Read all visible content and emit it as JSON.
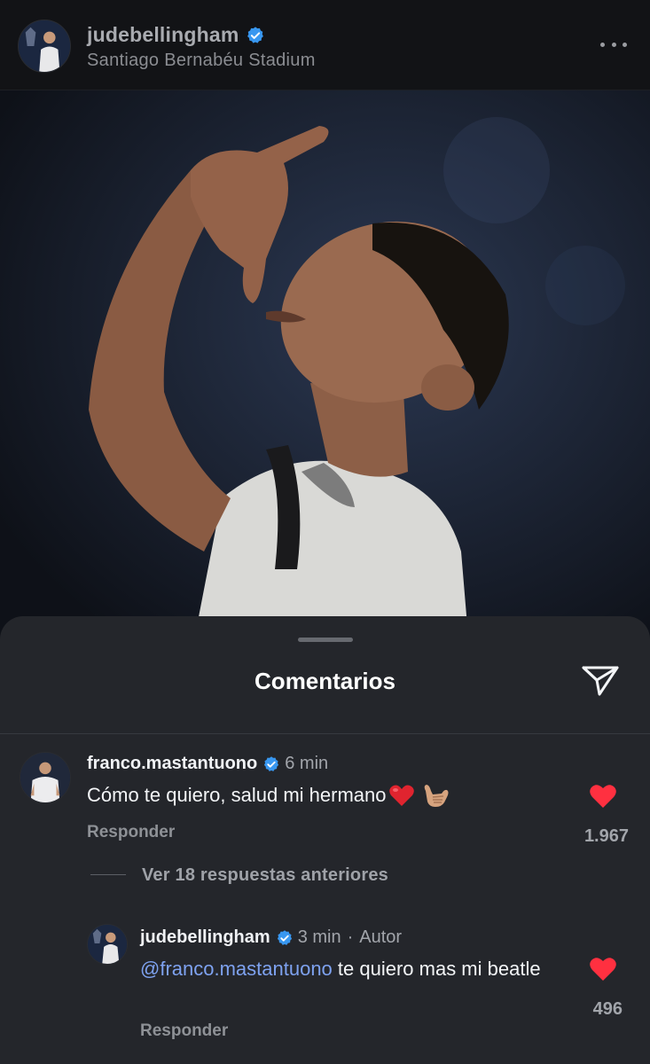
{
  "post": {
    "username": "judebellingham",
    "location": "Santiago Bernabéu Stadium",
    "verified": true
  },
  "comments_sheet": {
    "title": "Comentarios",
    "comments": [
      {
        "username": "franco.mastantuono",
        "verified": true,
        "time": "6 min",
        "text": "Cómo te quiero, salud mi hermano",
        "emojis": [
          "red-heart",
          "call-me-hand"
        ],
        "reply_label": "Responder",
        "likes": "1.967",
        "liked": true
      },
      {
        "username": "judebellingham",
        "verified": true,
        "time": "3 min",
        "separator": "·",
        "author_label": "Autor",
        "mention": "@franco.mastantuono",
        "text": " te quiero mas mi beatle",
        "reply_label": "Responder",
        "likes": "496",
        "liked": true
      }
    ],
    "view_replies_label": "Ver 18 respuestas anteriores"
  },
  "colors": {
    "verified_blue": "#3897f0",
    "like_red": "#ff3040",
    "mention_blue": "#7ea2f0",
    "sheet_bg": "#24262b"
  },
  "icons": {
    "more": "more-horizontal-icon",
    "share": "paper-plane-icon",
    "like": "heart-filled-icon",
    "verified": "verified-badge-icon"
  }
}
